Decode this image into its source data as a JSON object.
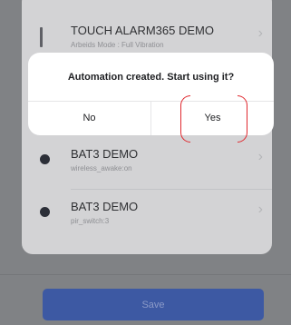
{
  "automation_list": {
    "items": [
      {
        "title": "TOUCH ALARM365 DEMO",
        "subtitle": "Arbeids Mode : Full Vibration",
        "icon": "bar"
      },
      {
        "title": "BAT3 DEMO",
        "subtitle": "wireless_awake:on",
        "icon": "dot"
      },
      {
        "title": "BAT3 DEMO",
        "subtitle": "pir_switch:3",
        "icon": "dot"
      }
    ],
    "chevron": "›"
  },
  "dialog": {
    "message": "Automation created. Start using it?",
    "no_label": "No",
    "yes_label": "Yes",
    "highlight_color": "#e0282e"
  },
  "footer": {
    "save_label": "Save",
    "save_color": "#3d59a3"
  }
}
